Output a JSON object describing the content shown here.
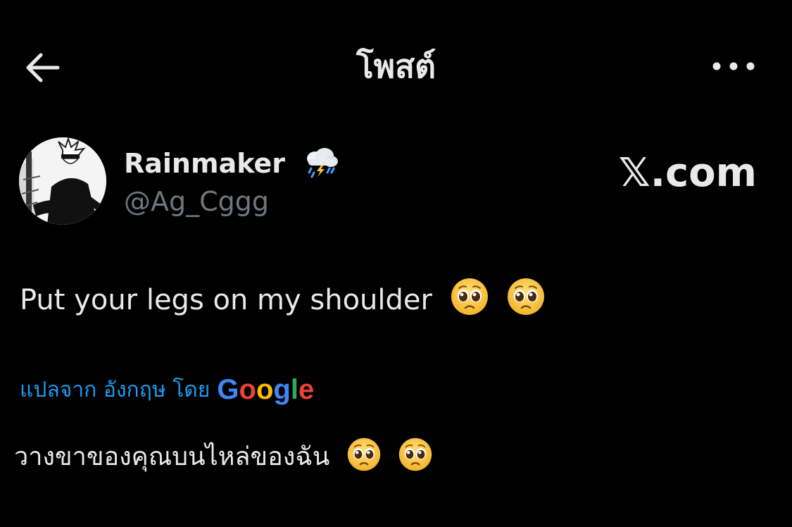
{
  "header": {
    "title": "โพสต์",
    "back_icon": "arrow-left-icon",
    "more_icon": "more-horizontal-icon"
  },
  "post": {
    "display_name": "Rainmaker",
    "name_emoji": "cloud-with-lightning-and-rain-icon",
    "handle": "@Ag_Cggg",
    "watermark": "𝕏.com",
    "text": "Put your legs on my shoulder",
    "text_emojis": [
      "pleading-face-icon",
      "pleading-face-icon"
    ],
    "translation": {
      "label": "แปลจาก อังกฤษ โดย",
      "provider": "Google",
      "text": "วางขาของคุณบนไหล่ของฉัน",
      "text_emojis": [
        "pleading-face-icon",
        "pleading-face-icon"
      ]
    }
  },
  "colors": {
    "background": "#000000",
    "primary_text": "#e7e9ea",
    "secondary_text": "#71767b",
    "link": "#1d9bf0",
    "google_blue": "#4285f4",
    "google_red": "#ea4335",
    "google_yellow": "#fbbc05",
    "google_green": "#34a853"
  }
}
